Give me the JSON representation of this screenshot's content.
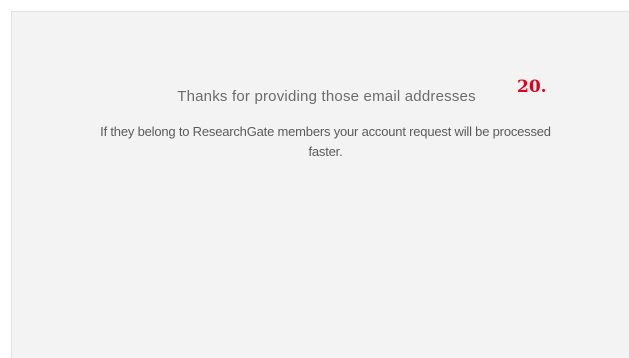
{
  "confirmation": {
    "heading": "Thanks for providing those email addresses",
    "step_number": "20.",
    "message": "If they belong to ResearchGate members your account request will be processed faster."
  },
  "colors": {
    "panel_background": "#f3f3f3",
    "heading_text": "#6c6c6c",
    "step_number": "#e0001a"
  }
}
